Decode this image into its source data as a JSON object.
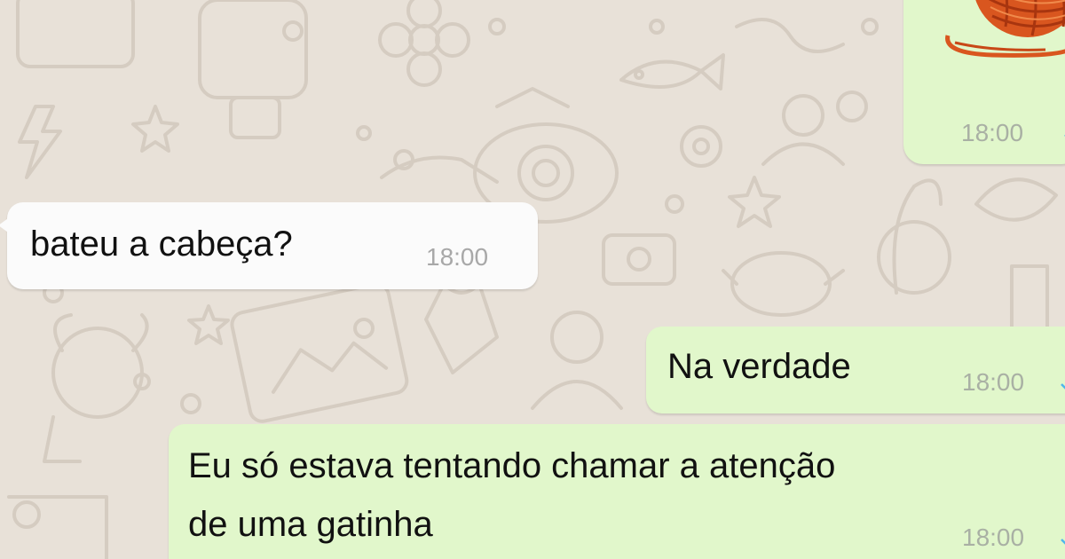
{
  "messages": [
    {
      "id": "sticker",
      "direction": "outgoing",
      "type": "sticker",
      "sticker_icon": "yarn-ball-sticker",
      "time": "18:00",
      "status": "read"
    },
    {
      "id": "m1",
      "direction": "incoming",
      "text": "bateu a cabeça?",
      "time": "18:00"
    },
    {
      "id": "m2",
      "direction": "outgoing",
      "text": "Na verdade",
      "time": "18:00",
      "status": "read"
    },
    {
      "id": "m3",
      "direction": "outgoing",
      "lines": [
        "Eu só estava tentando chamar a atenção",
        "de uma gatinha"
      ],
      "time": "18:00",
      "status": "read"
    }
  ],
  "colors": {
    "wallpaper": "#e8e1d8",
    "doodle": "#d5ccc1",
    "incoming_bubble": "#fbfbfb",
    "outgoing_bubble": "#e1f7cb",
    "text": "#111111",
    "time": "#a9b0a4",
    "read_check": "#4fb6ec",
    "yarn": "#d9561f"
  }
}
